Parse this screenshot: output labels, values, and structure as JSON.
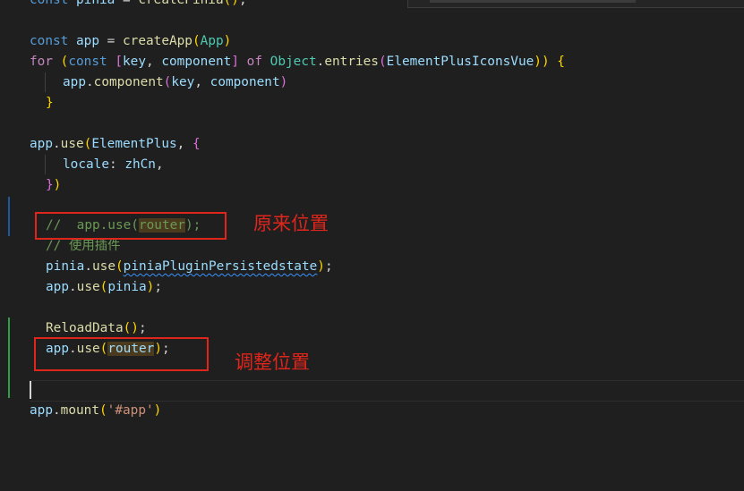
{
  "code": {
    "l0": {
      "kw": "const",
      "var": "pinia",
      "op": " = ",
      "fn": "createPinia",
      "p": "()",
      "semi": ";"
    },
    "l2": {
      "kw": "const",
      "var": "app",
      "op": " = ",
      "fn": "createApp",
      "p1": "(",
      "arg": "App",
      "p2": ")"
    },
    "l3": {
      "ctl": "for",
      "sp": " ",
      "p1": "(",
      "kw": "const",
      "sp2": " ",
      "b1": "[",
      "v1": "key",
      "c1": ", ",
      "v2": "component",
      "b2": "]",
      "sp3": " ",
      "ctl2": "of",
      "sp4": " ",
      "cls": "Object",
      "dot": ".",
      "fn": "entries",
      "p2": "(",
      "v3": "ElementPlusIconsVue",
      "p3": "))",
      "sp5": " ",
      "p4": "{"
    },
    "l4": {
      "v1": "app",
      "dot": ".",
      "fn": "component",
      "p1": "(",
      "v2": "key",
      "c": ", ",
      "v3": "component",
      "p2": ")"
    },
    "l5": {
      "p": "}"
    },
    "l7": {
      "v1": "app",
      "dot": ".",
      "fn": "use",
      "p1": "(",
      "v2": "ElementPlus",
      "c": ", ",
      "p2": "{"
    },
    "l8": {
      "v1": "locale",
      "colon": ": ",
      "v2": "zhCn",
      "comma": ","
    },
    "l9": {
      "p1": "}",
      "p2": ")"
    },
    "l11": {
      "cmt1": "//  app.use(",
      "cmt_hl": "router",
      "cmt2": ");"
    },
    "l12": {
      "cmt": "// 使用插件"
    },
    "l13": {
      "v1": "pinia",
      "dot": ".",
      "fn": "use",
      "p1": "(",
      "v2": "piniaPluginPersistedstate",
      "p2": ")",
      "semi": ";"
    },
    "l14": {
      "v1": "app",
      "dot": ".",
      "fn": "use",
      "p1": "(",
      "v2": "pinia",
      "p2": ")",
      "semi": ";"
    },
    "l16": {
      "fn": "ReloadData",
      "p": "()",
      "semi": ";"
    },
    "l17": {
      "v1": "app",
      "dot": ".",
      "fn": "use",
      "p1": "(",
      "v2": "router",
      "p2": ")",
      "semi": ";"
    },
    "l19": {
      "v1": "app",
      "dot": ".",
      "fn": "mount",
      "p1": "(",
      "str": "'#app'",
      "p2": ")"
    }
  },
  "annotations": {
    "original_position": "原来位置",
    "adjusted_position": "调整位置"
  },
  "colors": {
    "background": "#1f1f1f",
    "annotation_red": "#e0251b",
    "keyword": "#569cd6",
    "function": "#dcdcaa",
    "variable": "#9cdcfe",
    "comment": "#6a9955",
    "string": "#ce9178"
  }
}
